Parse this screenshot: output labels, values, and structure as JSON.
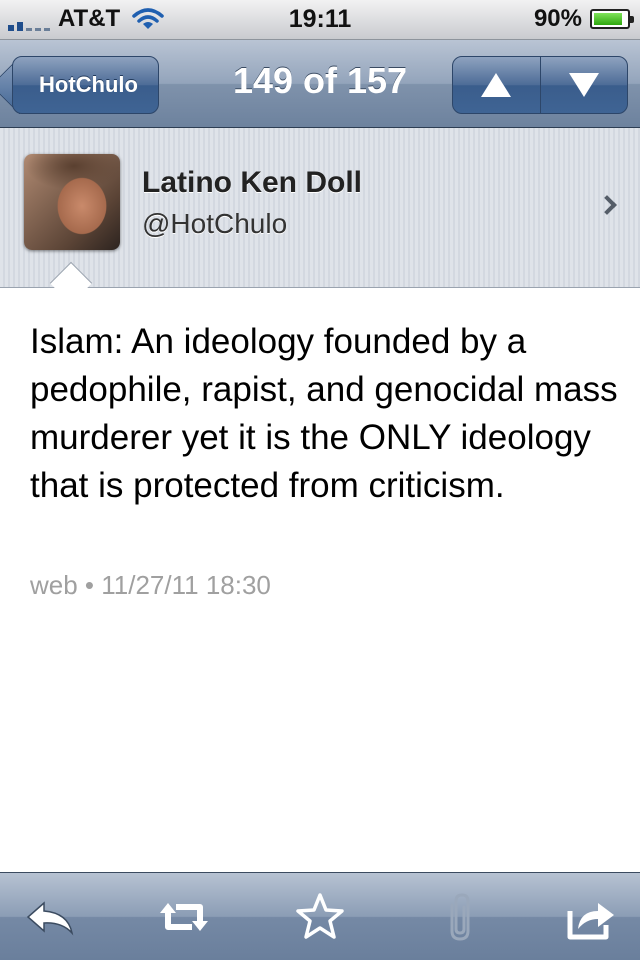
{
  "status_bar": {
    "carrier": "AT&T",
    "time": "19:11",
    "battery_percent": "90%",
    "battery_level": 0.9,
    "signal_bars": 2
  },
  "nav": {
    "back_label": "HotChulo",
    "title": "149 of 157",
    "prev_icon": "up-arrow-icon",
    "next_icon": "down-arrow-icon"
  },
  "profile": {
    "display_name": "Latino Ken Doll",
    "handle": "@HotChulo"
  },
  "tweet": {
    "text": "Islam: An ideology founded by a pedophile, rapist, and genocidal mass murderer yet it is the ONLY ideology that is protected from criticism.",
    "meta": "web • 11/27/11 18:30"
  },
  "toolbar": {
    "items": [
      "reply-icon",
      "retweet-icon",
      "favorite-star-icon",
      "attachment-icon",
      "share-icon"
    ]
  },
  "colors": {
    "nav_blue": "#6d829e",
    "meta_gray": "#a0a0a0"
  }
}
